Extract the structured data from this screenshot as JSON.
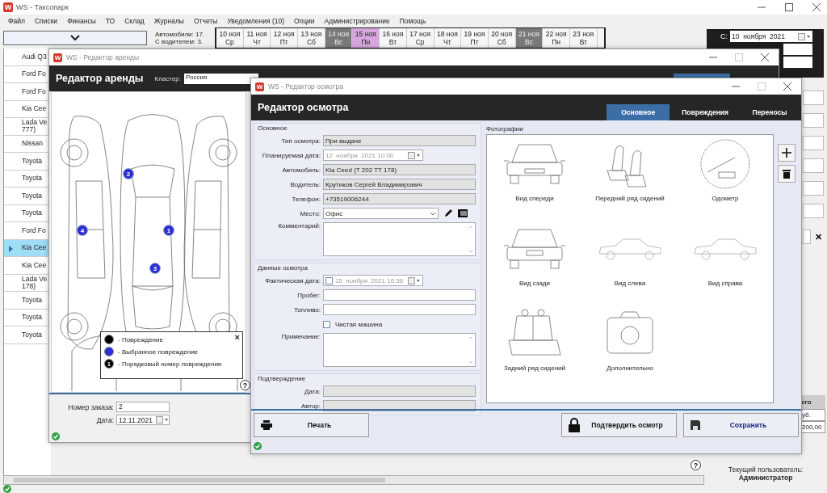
{
  "main_window": {
    "logo": "W",
    "title": "WS - Таксопарк"
  },
  "menu": [
    "Файл",
    "Списки",
    "Финансы",
    "ТО",
    "Склад",
    "Журналы",
    "Отчеты",
    "Уведомления (10)",
    "Опции",
    "Администрирование",
    "Помощь"
  ],
  "summary": [
    "Автомобили: 17.",
    "С водителем: 3."
  ],
  "calendar": [
    {
      "date": "10 ноя",
      "weekday": "Ср",
      "selected": false,
      "holiday": false
    },
    {
      "date": "11 ноя",
      "weekday": "Чт",
      "selected": false,
      "holiday": false
    },
    {
      "date": "12 ноя",
      "weekday": "Пт",
      "selected": false,
      "holiday": false
    },
    {
      "date": "13 ноя",
      "weekday": "Сб",
      "selected": false,
      "holiday": false
    },
    {
      "date": "14 ноя",
      "weekday": "Вс",
      "selected": false,
      "holiday": true
    },
    {
      "date": "15 ноя",
      "weekday": "Пн",
      "selected": true,
      "holiday": false
    },
    {
      "date": "16 ноя",
      "weekday": "Вт",
      "selected": false,
      "holiday": false
    },
    {
      "date": "17 ноя",
      "weekday": "Ср",
      "selected": false,
      "holiday": false
    },
    {
      "date": "18 ноя",
      "weekday": "Чт",
      "selected": false,
      "holiday": false
    },
    {
      "date": "19 ноя",
      "weekday": "Пт",
      "selected": false,
      "holiday": false
    },
    {
      "date": "20 ноя",
      "weekday": "Сб",
      "selected": false,
      "holiday": false
    },
    {
      "date": "21 ноя",
      "weekday": "Вс",
      "selected": false,
      "holiday": true
    },
    {
      "date": "22 ноя",
      "weekday": "Пн",
      "selected": false,
      "holiday": false
    },
    {
      "date": "23 ноя",
      "weekday": "Вт",
      "selected": false,
      "holiday": false
    }
  ],
  "date_range": {
    "label": "С:",
    "value": "10  ноября  2021"
  },
  "cars": [
    {
      "lines": [
        "Audi Q3"
      ],
      "selected": false
    },
    {
      "lines": [
        "Ford Fo"
      ],
      "selected": false
    },
    {
      "lines": [
        "Ford Fo"
      ],
      "selected": false
    },
    {
      "lines": [
        "Kia Cee"
      ],
      "selected": false
    },
    {
      "lines": [
        "Lada Ve",
        "777)"
      ],
      "selected": false
    },
    {
      "lines": [
        "Nissan"
      ],
      "selected": false
    },
    {
      "lines": [
        "Toyota"
      ],
      "selected": false
    },
    {
      "lines": [
        "Toyota"
      ],
      "selected": false
    },
    {
      "lines": [
        "Toyota"
      ],
      "selected": false
    },
    {
      "lines": [
        "Toyota"
      ],
      "selected": false
    },
    {
      "lines": [
        "Ford Fo"
      ],
      "selected": false
    },
    {
      "lines": [
        "Kia Cee"
      ],
      "selected": true
    },
    {
      "lines": [
        "Kia Cee"
      ],
      "selected": false
    },
    {
      "lines": [
        "Lada Ve",
        "178)"
      ],
      "selected": false
    },
    {
      "lines": [
        "Toyota"
      ],
      "selected": false
    },
    {
      "lines": [
        "Toyota"
      ],
      "selected": false
    },
    {
      "lines": [
        "Toyota"
      ],
      "selected": false
    }
  ],
  "clear_button": "✕",
  "totals": {
    "header": "его",
    "cells": [
      "уб.",
      "200,00"
    ]
  },
  "help": "?",
  "current_user": {
    "label": "Текущий пользователь:",
    "name": "Администратор"
  },
  "rental_editor": {
    "logo": "W",
    "title": "WS - Редактор аренды",
    "heading": "Редактор аренды",
    "cluster_label": "Кластер:",
    "cluster": "Россия",
    "markers": [
      {
        "number": "1",
        "selected": true
      },
      {
        "number": "2",
        "selected": true
      },
      {
        "number": "3",
        "selected": true
      },
      {
        "number": "4",
        "selected": true
      }
    ],
    "legend": {
      "close": "×",
      "items": [
        {
          "kind": "damage",
          "label": "- Повреждение"
        },
        {
          "kind": "selected",
          "label": "- Выбранное повреждение"
        },
        {
          "kind": "numbered",
          "symbol": "1",
          "label": "- Порядковый номер повреждения"
        }
      ]
    },
    "order_label": "Номер заказа:",
    "order": "2",
    "date_label": "Дата:",
    "date": "12.11.2021"
  },
  "inspection_editor": {
    "logo": "W",
    "title": "WS - Редактор осмотра",
    "heading": "Редактор осмотра",
    "tabs": [
      {
        "label": "Основное",
        "selected": true
      },
      {
        "label": "Повреждения",
        "selected": false
      },
      {
        "label": "Переносы",
        "selected": false
      }
    ],
    "groups": [
      {
        "title": "Основное",
        "fields": [
          {
            "kind": "text",
            "label": "Тип осмотра:",
            "value": "При выдаче",
            "readonly": true
          },
          {
            "kind": "date",
            "label": "Планируемая дата:",
            "value": "12  ноября  2021 10:00",
            "disabled": true
          },
          {
            "kind": "text",
            "label": "Автомобиль:",
            "value": "Kia Ceed (T 202 TT 178)",
            "readonly": true
          },
          {
            "kind": "text",
            "label": "Водитель:",
            "value": "Крутиков Сергей Владимирович",
            "readonly": true
          },
          {
            "kind": "text",
            "label": "Телефон:",
            "value": "+73519006244",
            "readonly": true
          },
          {
            "kind": "select",
            "label": "Место:",
            "value": "Офис"
          },
          {
            "kind": "textarea",
            "label": "Комментарий:"
          }
        ]
      },
      {
        "title": "Данные осмотра",
        "fields": [
          {
            "kind": "date",
            "label": "Фактическая дата:",
            "value": "15  ноября  2021 16:36",
            "disabled": true,
            "checked": false
          },
          {
            "kind": "text",
            "label": "Пробег:",
            "readonly": false
          },
          {
            "kind": "text",
            "label": "Топливо:",
            "readonly": false
          },
          {
            "kind": "checkbox",
            "label": "Чистая машина",
            "checked": false
          },
          {
            "kind": "textarea",
            "label": "Примечание:"
          }
        ]
      },
      {
        "title": "Подтверждение",
        "fields": [
          {
            "kind": "text",
            "label": "Дата:",
            "readonly": true
          },
          {
            "kind": "text",
            "label": "Автор:",
            "readonly": true
          }
        ]
      }
    ],
    "photos_title": "Фотографии",
    "photos": [
      {
        "kind": "front",
        "label": "Вид спереди"
      },
      {
        "kind": "front-seats",
        "label": "Передний ряд сидений"
      },
      {
        "kind": "odometer",
        "label": "Одометр"
      },
      {
        "kind": "rear",
        "label": "Вид сзади"
      },
      {
        "kind": "left",
        "label": "Вид слева"
      },
      {
        "kind": "right",
        "label": "Вид справа"
      },
      {
        "kind": "rear-seats",
        "label": "Задний ряд сидений"
      },
      {
        "kind": "camera",
        "label": "Дополнительно"
      }
    ],
    "buttons": [
      {
        "kind": "print",
        "label": "Печать"
      },
      {
        "kind": "confirm",
        "label": "Подтвердить осмотр"
      },
      {
        "kind": "save",
        "label": "Сохранить"
      }
    ]
  }
}
